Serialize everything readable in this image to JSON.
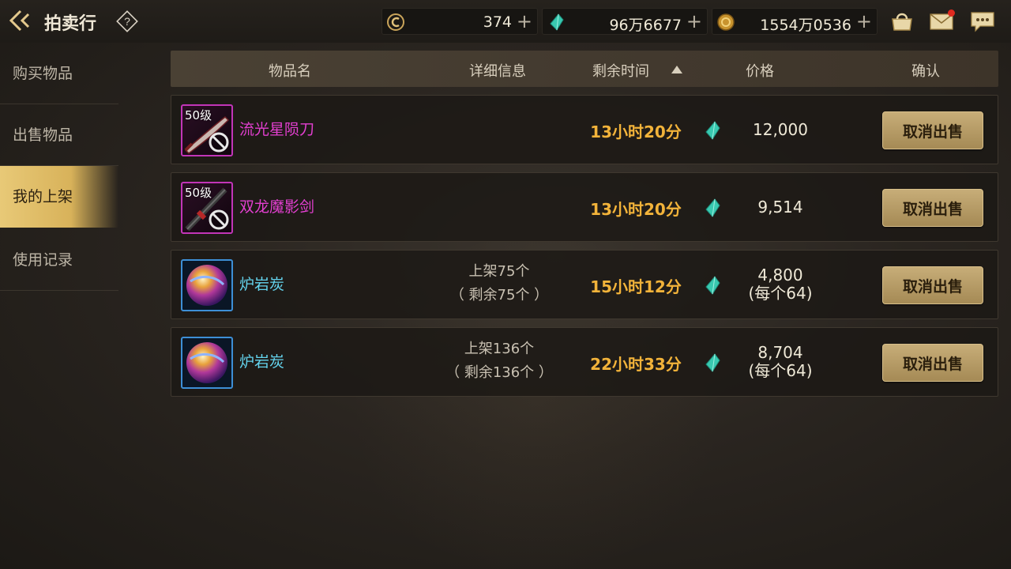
{
  "app": {
    "title": "拍卖行"
  },
  "currencies": [
    {
      "name": "coupon",
      "value": "374"
    },
    {
      "name": "gem",
      "value": "96万6677"
    },
    {
      "name": "gold",
      "value": "1554万0536"
    }
  ],
  "sidebar": {
    "items": [
      {
        "label": "购买物品",
        "active": false
      },
      {
        "label": "出售物品",
        "active": false
      },
      {
        "label": "我的上架",
        "active": true
      },
      {
        "label": "使用记录",
        "active": false
      }
    ]
  },
  "table": {
    "headers": {
      "name": "物品名",
      "detail": "详细信息",
      "time": "剩余时间",
      "price": "价格",
      "confirm": "确认"
    },
    "sort": {
      "column": "剩余时间",
      "direction": "ascending"
    },
    "rows": [
      {
        "level": "50级",
        "name": "流光星陨刀",
        "detail_line1": "",
        "detail_line2": "",
        "time": "13小时20分",
        "price": "12,000",
        "price_note": "",
        "button": "取消出售"
      },
      {
        "level": "50级",
        "name": "双龙魔影剑",
        "detail_line1": "",
        "detail_line2": "",
        "time": "13小时20分",
        "price": "9,514",
        "price_note": "",
        "button": "取消出售"
      },
      {
        "level": "",
        "name": "炉岩炭",
        "detail_line1": "上架75个",
        "detail_line2": "（ 剩余75个 ）",
        "time": "15小时12分",
        "price": "4,800",
        "price_note": "(每个64)",
        "button": "取消出售"
      },
      {
        "level": "",
        "name": "炉岩炭",
        "detail_line1": "上架136个",
        "detail_line2": "（ 剩余136个 ）",
        "time": "22小时33分",
        "price": "8,704",
        "price_note": "(每个64)",
        "button": "取消出售"
      }
    ]
  },
  "colors": {
    "accent_gold": "#d8b25a",
    "time_orange": "#f2b33a",
    "item_pink": "#e33fd0",
    "item_cyan": "#64d4ee"
  }
}
